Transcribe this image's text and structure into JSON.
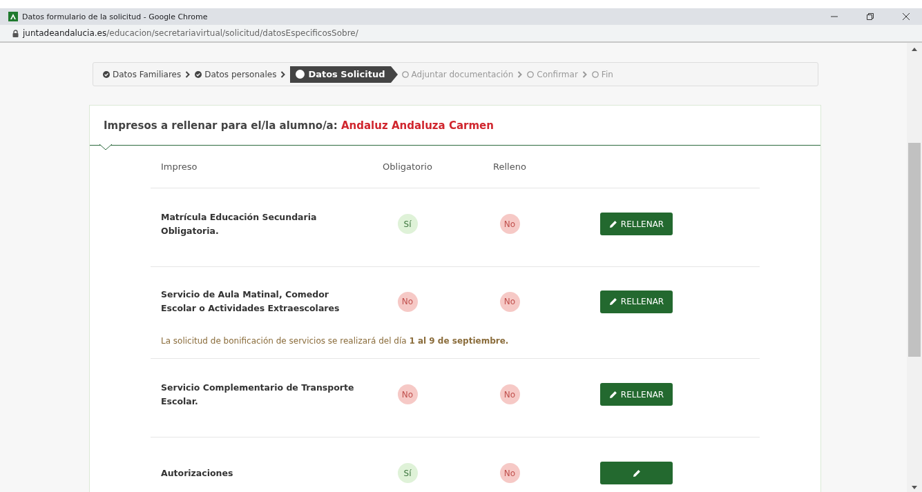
{
  "window": {
    "title": "Datos formulario de la solicitud - Google Chrome"
  },
  "address_bar": {
    "domain": "juntadeandalucia.es",
    "path": "/educacion/secretariavirtual/solicitud/datosEspecificosSobre/"
  },
  "steps": [
    {
      "label": "Datos Familiares",
      "kind": "done"
    },
    {
      "label": "Datos personales",
      "kind": "done"
    },
    {
      "label": "Datos Solicitud",
      "kind": "current"
    },
    {
      "label": "Adjuntar documentación",
      "kind": "pending"
    },
    {
      "label": "Confirmar",
      "kind": "pending"
    },
    {
      "label": "Fin",
      "kind": "pending"
    }
  ],
  "card": {
    "title": "Impresos a rellenar para el/la alumno/a:",
    "student": "Andaluz Andaluza Carmen"
  },
  "table": {
    "columns": [
      "Impreso",
      "Obligatorio",
      "Relleno"
    ],
    "rows": [
      {
        "name": "Matrícula Educación Secundaria Obligatoria.",
        "mandatory": {
          "text": "Sí",
          "positive": true
        },
        "filled": {
          "text": "No",
          "positive": false
        },
        "button": "RELLENAR"
      },
      {
        "name": "Servicio de Aula Matinal, Comedor Escolar o Actividades Extraescolares",
        "mandatory": {
          "text": "No",
          "positive": false
        },
        "filled": {
          "text": "No",
          "positive": false
        },
        "button": "RELLENAR",
        "note": "La solicitud de bonificación de servicios se realizará del día **1 al 9 de septiembre.**"
      },
      {
        "name": "Servicio Complementario de Transporte Escolar.",
        "mandatory": {
          "text": "No",
          "positive": false
        },
        "filled": {
          "text": "No",
          "positive": false
        },
        "button": "RELLENAR"
      },
      {
        "name": "Autorizaciones",
        "mandatory": {
          "text": "Sí",
          "positive": true
        },
        "filled": {
          "text": "No",
          "positive": false
        }
      }
    ]
  }
}
